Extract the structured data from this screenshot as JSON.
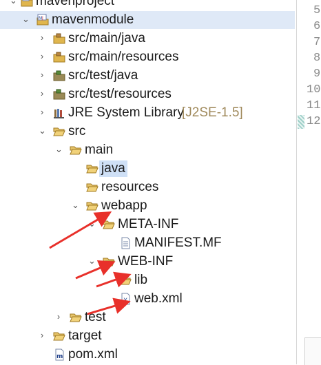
{
  "tree": {
    "items": [
      {
        "label": "mavenproject",
        "decoration": ""
      },
      {
        "label": "mavenmodule",
        "decoration": ""
      },
      {
        "label": "src/main/java",
        "decoration": ""
      },
      {
        "label": "src/main/resources",
        "decoration": ""
      },
      {
        "label": "src/test/java",
        "decoration": ""
      },
      {
        "label": "src/test/resources",
        "decoration": ""
      },
      {
        "label": "JRE System Library",
        "decoration": "[J2SE-1.5]"
      },
      {
        "label": "src",
        "decoration": ""
      },
      {
        "label": "main",
        "decoration": ""
      },
      {
        "label": "java",
        "decoration": ""
      },
      {
        "label": "resources",
        "decoration": ""
      },
      {
        "label": "webapp",
        "decoration": ""
      },
      {
        "label": "META-INF",
        "decoration": ""
      },
      {
        "label": "MANIFEST.MF",
        "decoration": ""
      },
      {
        "label": "WEB-INF",
        "decoration": ""
      },
      {
        "label": "lib",
        "decoration": ""
      },
      {
        "label": "web.xml",
        "decoration": ""
      },
      {
        "label": "test",
        "decoration": ""
      },
      {
        "label": "target",
        "decoration": ""
      },
      {
        "label": "pom.xml",
        "decoration": ""
      }
    ]
  },
  "editor": {
    "line_numbers": [
      "5",
      "6",
      "7",
      "8",
      "9",
      "10",
      "11",
      "12"
    ]
  },
  "colors": {
    "selection": "#dfe9f7",
    "folder": "#e0b64e",
    "arrow": "#e8302a",
    "decoration": "#a08a5c"
  },
  "icons": {
    "project": "project-icon",
    "package_folder": "source-folder-icon",
    "library": "library-icon",
    "folder": "folder-icon",
    "file": "file-icon",
    "xml": "xml-file-icon"
  }
}
